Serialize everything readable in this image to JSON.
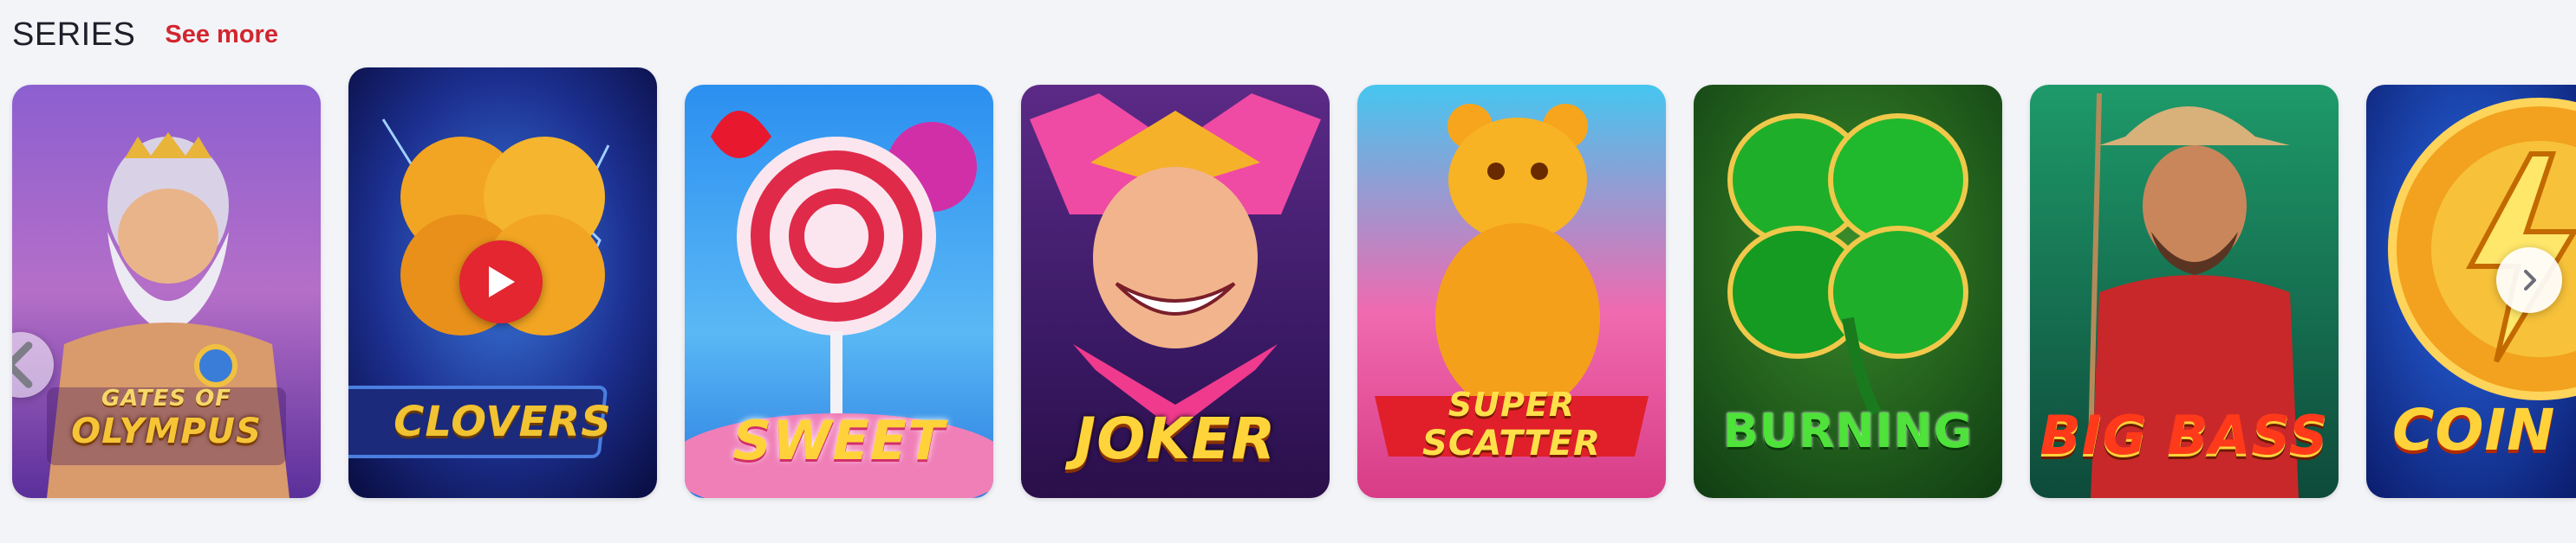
{
  "section": {
    "title": "SERIES",
    "see_more_label": "See more"
  },
  "games": [
    {
      "logo": "Gates of\nOLYMPUS",
      "logo_line1": "Gates of",
      "logo_line2": "OLYMPUS"
    },
    {
      "logo": "CLOVERS"
    },
    {
      "logo": "SWEET"
    },
    {
      "logo": "JOKER"
    },
    {
      "logo_line1": "SUPER",
      "logo_line2": "SCATTER"
    },
    {
      "logo": "BURNING"
    },
    {
      "logo": "BIG BASS"
    },
    {
      "logo": "COIN"
    }
  ],
  "icons": {
    "prev": "chevron-left-icon",
    "next": "chevron-right-icon",
    "play": "play-icon"
  },
  "colors": {
    "accent": "#d2262f",
    "play_button": "#e3262f",
    "background": "#f3f4f8"
  }
}
